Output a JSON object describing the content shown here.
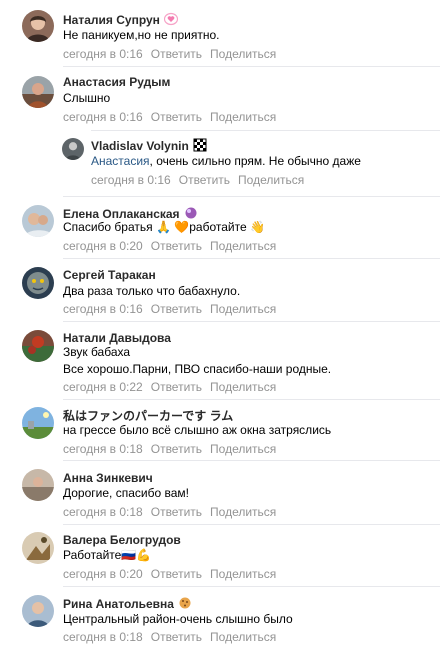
{
  "comments": [
    {
      "author": "Наталия Супрун",
      "text": "Не паникуем,но не приятно.",
      "time": "сегодня в 0:16",
      "reply": "Ответить",
      "share": "Поделиться",
      "badge": "pink-heart-badge"
    },
    {
      "author": "Анастасия Рудым",
      "text": "Слышно",
      "time": "сегодня в 0:16",
      "reply": "Ответить",
      "share": "Поделиться"
    },
    {
      "author": "Vladislav Volynin",
      "reply_to": "Анастасия",
      "text": ", очень сильно прям. Не обычно даже",
      "time": "сегодня в 0:16",
      "reply": "Ответить",
      "share": "Поделиться",
      "badge": "checkered-flag-badge"
    },
    {
      "author": "Елена Оплаканская",
      "text_parts": [
        "Спасибо братья ",
        " ",
        "работайте "
      ],
      "emojis": [
        "🙏",
        "🧡",
        "👋"
      ],
      "time": "сегодня в 0:20",
      "reply": "Ответить",
      "share": "Поделиться",
      "badge": "purple-orb-badge"
    },
    {
      "author": "Сергей Таракан",
      "text": "Два раза только что бабахнуло.",
      "time": "сегодня в 0:16",
      "reply": "Ответить",
      "share": "Поделиться"
    },
    {
      "author": "Натали Давыдова",
      "text_line1": "Звук бабаха",
      "text_line2": "Все хорошо.Парни, ПВО спасибо-наши родные.",
      "time": "сегодня в 0:22",
      "reply": "Ответить",
      "share": "Поделиться"
    },
    {
      "author": "私はファンのパーカーです ラム",
      "text": "на грессе было всё слышно аж окна затряслись",
      "time": "сегодня в 0:18",
      "reply": "Ответить",
      "share": "Поделиться"
    },
    {
      "author": "Анна Зинкевич",
      "text": "Дорогие, спасибо вам!",
      "time": "сегодня в 0:18",
      "reply": "Ответить",
      "share": "Поделиться"
    },
    {
      "author": "Валера Белогрудов",
      "text": "Работайте",
      "emojis_after": [
        "🇷🇺",
        "💪"
      ],
      "time": "сегодня в 0:20",
      "reply": "Ответить",
      "share": "Поделиться"
    },
    {
      "author": "Рина Анатольевна",
      "text": "Центральный район-очень слышно было",
      "time": "сегодня в 0:18",
      "reply": "Ответить",
      "share": "Поделиться",
      "badge": "cookie-badge"
    }
  ],
  "colors": {
    "link": "#2a5885",
    "meta": "#939393",
    "divider": "#e7e8ec"
  }
}
